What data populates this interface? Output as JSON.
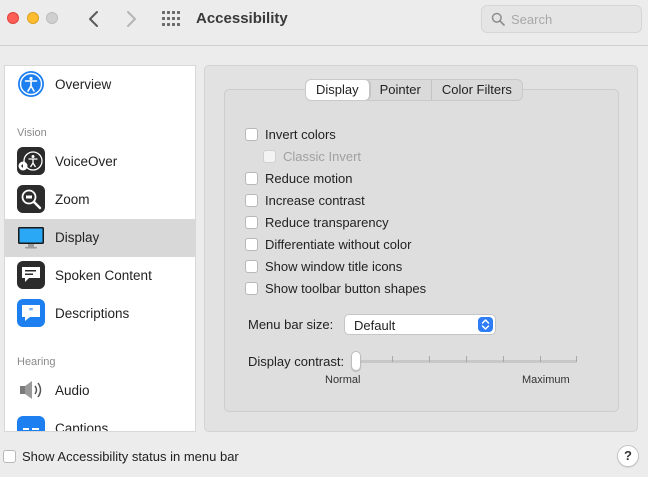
{
  "window": {
    "title": "Accessibility",
    "search_placeholder": "Search"
  },
  "sidebar": {
    "top_items": [
      {
        "label": "Overview",
        "icon": "accessibility-overview-icon"
      }
    ],
    "sections": [
      {
        "label": "Vision"
      },
      {
        "label": "Hearing"
      }
    ],
    "vision_items": [
      {
        "label": "VoiceOver",
        "icon": "voiceover-icon"
      },
      {
        "label": "Zoom",
        "icon": "zoom-icon"
      },
      {
        "label": "Display",
        "icon": "display-icon",
        "selected": true
      },
      {
        "label": "Spoken Content",
        "icon": "spoken-content-icon"
      },
      {
        "label": "Descriptions",
        "icon": "descriptions-icon"
      }
    ],
    "hearing_items": [
      {
        "label": "Audio",
        "icon": "speaker-icon"
      },
      {
        "label": "Captions",
        "icon": "captions-icon"
      }
    ]
  },
  "tabs": [
    {
      "label": "Display",
      "active": true
    },
    {
      "label": "Pointer",
      "active": false
    },
    {
      "label": "Color Filters",
      "active": false
    }
  ],
  "options": [
    {
      "label": "Invert colors",
      "checked": false,
      "disabled": false
    },
    {
      "label": "Classic Invert",
      "checked": false,
      "disabled": true
    },
    {
      "label": "Reduce motion",
      "checked": false,
      "disabled": false
    },
    {
      "label": "Increase contrast",
      "checked": false,
      "disabled": false
    },
    {
      "label": "Reduce transparency",
      "checked": false,
      "disabled": false
    },
    {
      "label": "Differentiate without color",
      "checked": false,
      "disabled": false
    },
    {
      "label": "Show window title icons",
      "checked": false,
      "disabled": false
    },
    {
      "label": "Show toolbar button shapes",
      "checked": false,
      "disabled": false
    }
  ],
  "menu_bar_size": {
    "label": "Menu bar size:",
    "value": "Default"
  },
  "display_contrast": {
    "label": "Display contrast:",
    "min_label": "Normal",
    "max_label": "Maximum",
    "value": 0
  },
  "footer": {
    "status_checkbox_label": "Show Accessibility status in menu bar",
    "status_checked": false,
    "help_label": "?"
  },
  "colors": {
    "accent": "#2e7cf6",
    "close": "#fe5f57",
    "minimize": "#febc2e",
    "selection": "#d8d8d8"
  }
}
